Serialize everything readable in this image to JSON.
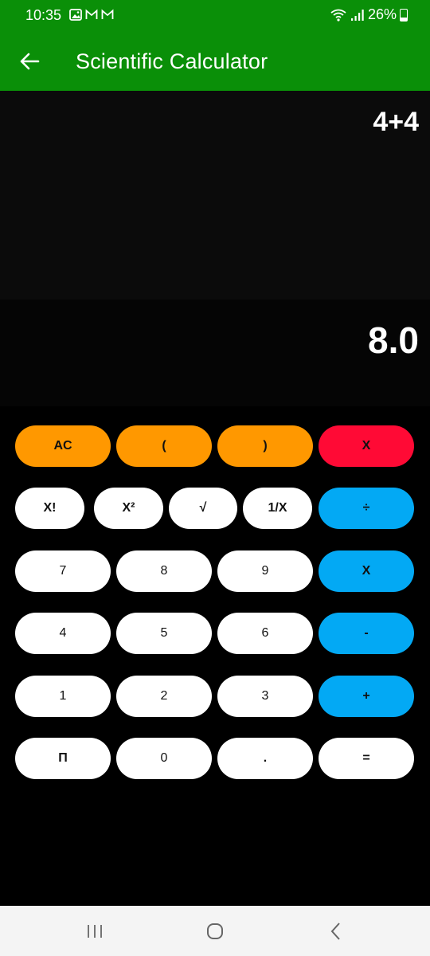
{
  "status": {
    "time": "10:35",
    "battery": "26%",
    "icons_left": [
      "image-notification-icon",
      "gmail-icon",
      "gmail-icon"
    ],
    "icons_right": [
      "wifi-icon",
      "signal-icon",
      "battery-icon"
    ]
  },
  "app_bar": {
    "title": "Scientific Calculator",
    "background": "#0a8f08"
  },
  "display": {
    "expression": "4+4",
    "result": "8.0"
  },
  "keypad": {
    "colors": {
      "orange": "#ff9800",
      "red": "#ff0a35",
      "blue": "#03a9f4",
      "white": "#ffffff"
    },
    "row1": {
      "ac": "AC",
      "open_paren": "(",
      "close_paren": ")",
      "clear": "X"
    },
    "row2": {
      "factorial": "X!",
      "square": "X²",
      "sqrt": "√",
      "reciprocal": "1/X",
      "divide": "÷"
    },
    "row3": {
      "seven": "7",
      "eight": "8",
      "nine": "9",
      "multiply": "X"
    },
    "row4": {
      "four": "4",
      "five": "5",
      "six": "6",
      "minus": "-"
    },
    "row5": {
      "one": "1",
      "two": "2",
      "three": "3",
      "plus": "+"
    },
    "row6": {
      "pi": "Π",
      "zero": "0",
      "dot": ".",
      "equals": "="
    }
  },
  "nav": {
    "icons": [
      "recent-apps-icon",
      "home-icon",
      "back-icon"
    ]
  }
}
